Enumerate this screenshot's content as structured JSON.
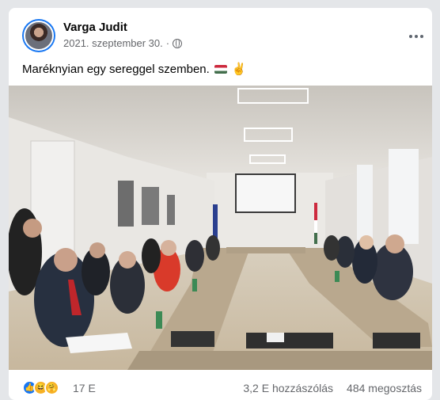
{
  "post": {
    "author": "Varga Judit",
    "date": "2021. szeptember 30.",
    "date_separator": "·",
    "privacy_icon": "globe-icon",
    "more_icon": "more-horizontal-icon",
    "text": "Maréknyian egy sereggel szemben.",
    "emojis": [
      "hungarian-flag",
      "victory-hand"
    ]
  },
  "photo": {
    "alt_icon": "photo"
  },
  "footer": {
    "reactions": [
      "like",
      "haha",
      "care"
    ],
    "reaction_count": "17 E",
    "comments": "3,2 E hozzászólás",
    "shares": "484 megosztás"
  },
  "colors": {
    "accent": "#1877f2",
    "secondary_text": "#65676b",
    "flag_red": "#cd2a3e",
    "flag_green": "#436f4d",
    "tie_red": "#c0262b"
  }
}
